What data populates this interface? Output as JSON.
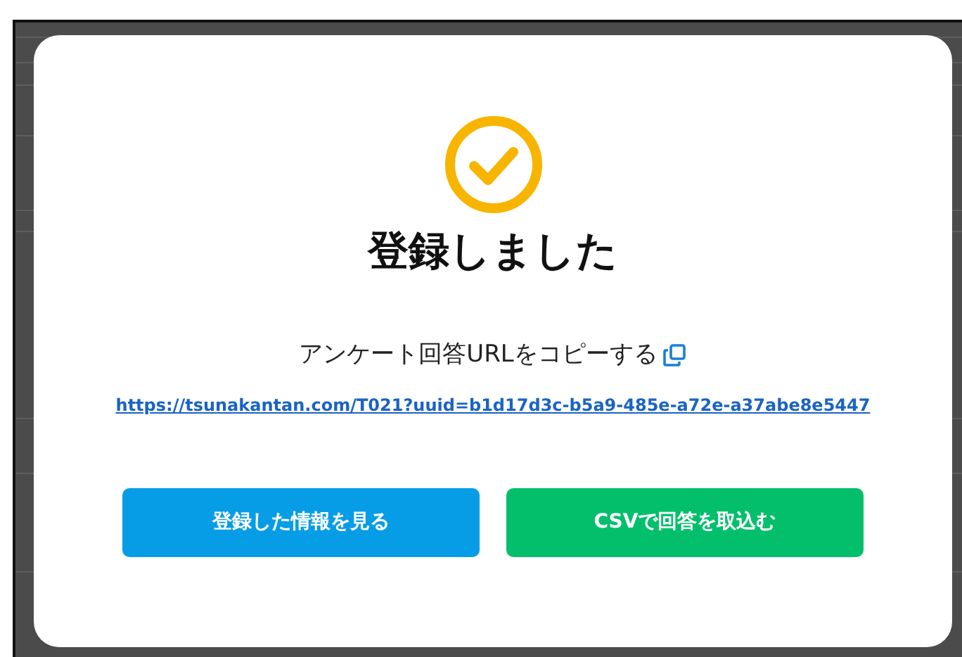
{
  "dialog": {
    "title": "登録しました",
    "copy_label": "アンケート回答URLをコピーする",
    "url": "https://tsunakantan.com/T021?uuid=b1d17d3c-b5a9-485e-a72e-a37abe8e5447",
    "buttons": [
      {
        "label": "登録した情報を見る",
        "kind": "primary"
      },
      {
        "label": "CSVで回答を取込む",
        "kind": "success"
      }
    ]
  }
}
